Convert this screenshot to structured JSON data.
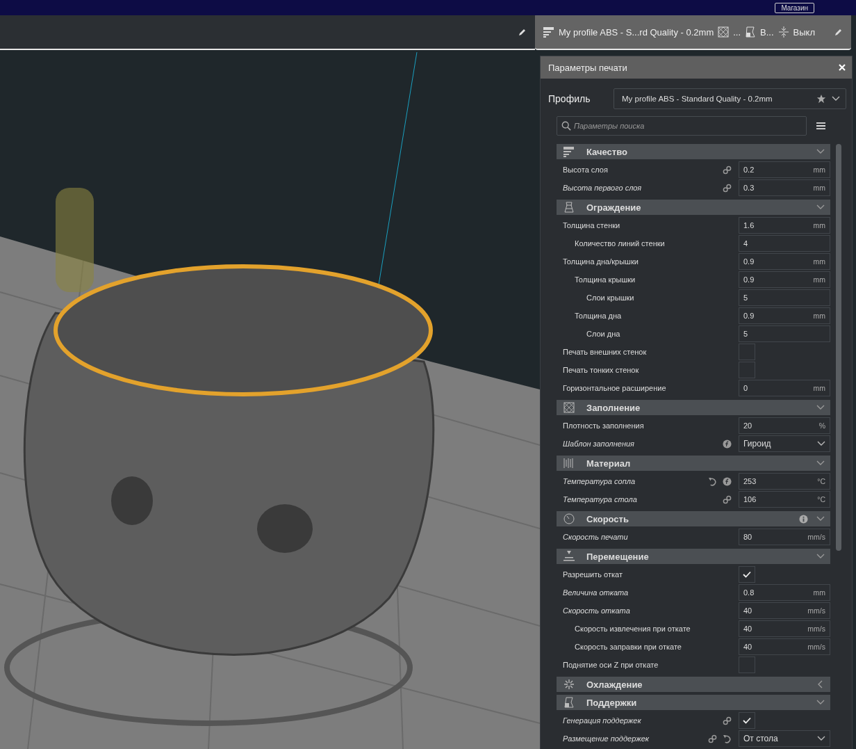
{
  "top_bar": {
    "store_button": "Магазин"
  },
  "header_tab": {
    "profile": "My profile ABS - S...rd Quality - 0.2mm",
    "infill": "...",
    "support": "В...",
    "adhesion": "Выкл"
  },
  "panel": {
    "title": "Параметры печати",
    "profile_label": "Профиль",
    "profile_value": "My profile ABS - Standard Quality - 0.2mm",
    "search_placeholder": "Параметры поиска"
  },
  "sections": [
    {
      "title": "Качество",
      "expanded": true,
      "info": false,
      "settings": [
        {
          "label": "Высота слоя",
          "italic": false,
          "linked": true,
          "kind": "number",
          "value": "0.2",
          "unit": "mm"
        },
        {
          "label": "Высота первого слоя",
          "italic": true,
          "linked": true,
          "kind": "number",
          "value": "0.3",
          "unit": "mm"
        }
      ]
    },
    {
      "title": "Ограждение",
      "expanded": true,
      "info": false,
      "settings": [
        {
          "label": "Толщина стенки",
          "italic": false,
          "kind": "number",
          "value": "1.6",
          "unit": "mm",
          "children": [
            {
              "label": "Количество линий стенки",
              "italic": false,
              "kind": "number",
              "value": "4"
            }
          ]
        },
        {
          "label": "Толщина дна/крышки",
          "italic": false,
          "kind": "number",
          "value": "0.9",
          "unit": "mm",
          "children": [
            {
              "label": "Толщина крышки",
              "italic": false,
              "kind": "number",
              "value": "0.9",
              "unit": "mm",
              "children": [
                {
                  "label": "Слои крышки",
                  "italic": false,
                  "kind": "number",
                  "value": "5"
                }
              ]
            },
            {
              "label": "Толщина дна",
              "italic": false,
              "kind": "number",
              "value": "0.9",
              "unit": "mm",
              "children": [
                {
                  "label": "Слои дна",
                  "italic": false,
                  "kind": "number",
                  "value": "5"
                }
              ]
            }
          ]
        },
        {
          "label": "Печать внешних стенок",
          "italic": false,
          "kind": "checkbox",
          "checked": false
        },
        {
          "label": "Печать тонких стенок",
          "italic": false,
          "kind": "checkbox",
          "checked": false
        },
        {
          "label": "Горизонтальное расширение",
          "italic": false,
          "kind": "number",
          "value": "0",
          "unit": "mm"
        }
      ]
    },
    {
      "title": "Заполнение",
      "expanded": true,
      "info": false,
      "settings": [
        {
          "label": "Плотность заполнения",
          "italic": false,
          "kind": "number",
          "value": "20",
          "unit": "%"
        },
        {
          "label": "Шаблон заполнения",
          "italic": true,
          "formula": true,
          "kind": "select",
          "value": "Гироид"
        }
      ]
    },
    {
      "title": "Материал",
      "expanded": true,
      "info": false,
      "settings": [
        {
          "label": "Температура сопла",
          "italic": true,
          "resettable": true,
          "formula": true,
          "kind": "number",
          "value": "253",
          "unit": "°C"
        },
        {
          "label": "Температура стола",
          "italic": true,
          "linked": true,
          "kind": "number",
          "value": "106",
          "unit": "°C"
        }
      ]
    },
    {
      "title": "Скорость",
      "expanded": true,
      "info": true,
      "settings": [
        {
          "label": "Скорость печати",
          "italic": true,
          "kind": "number",
          "value": "80",
          "unit": "mm/s"
        }
      ]
    },
    {
      "title": "Перемещение",
      "expanded": true,
      "info": false,
      "settings": [
        {
          "label": "Разрешить откат",
          "italic": false,
          "kind": "checkbox",
          "checked": true
        },
        {
          "label": "Величина отката",
          "italic": true,
          "kind": "number",
          "value": "0.8",
          "unit": "mm"
        },
        {
          "label": "Скорость отката",
          "italic": true,
          "kind": "number",
          "value": "40",
          "unit": "mm/s",
          "children": [
            {
              "label": "Скорость извлечения при откате",
              "italic": false,
              "kind": "number",
              "value": "40",
              "unit": "mm/s"
            },
            {
              "label": "Скорость заправки при откате",
              "italic": false,
              "kind": "number",
              "value": "40",
              "unit": "mm/s"
            }
          ]
        },
        {
          "label": "Поднятие оси Z при откате",
          "italic": false,
          "kind": "checkbox",
          "checked": false
        }
      ]
    },
    {
      "title": "Охлаждение",
      "expanded": false,
      "info": false
    },
    {
      "title": "Поддержки",
      "expanded": true,
      "info": false,
      "settings": [
        {
          "label": "Генерация поддержек",
          "italic": true,
          "linked": true,
          "kind": "checkbox",
          "checked": true
        },
        {
          "label": "Размещение поддержек",
          "italic": true,
          "linked": true,
          "resettable": true,
          "kind": "select",
          "value": "От стола"
        }
      ]
    }
  ]
}
